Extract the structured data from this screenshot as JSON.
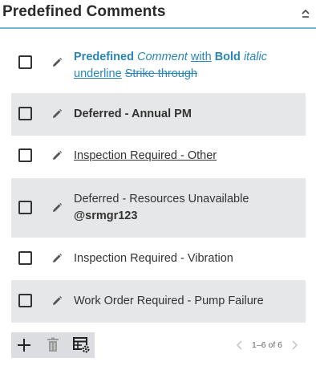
{
  "panel": {
    "title": "Predefined Comments",
    "collapse_icon": "chevron-up-icon"
  },
  "comments": [
    {
      "segments": [
        {
          "text": "Predefined",
          "style": "bold-blue"
        },
        {
          "text": " ",
          "style": "plain"
        },
        {
          "text": "Comment",
          "style": "italic-blue"
        },
        {
          "text": " ",
          "style": "plain"
        },
        {
          "text": "with",
          "style": "underline-blue"
        },
        {
          "text": " ",
          "style": "plain"
        },
        {
          "text": "Bold",
          "style": "bold-blue"
        },
        {
          "text": " ",
          "style": "plain"
        },
        {
          "text": "italic",
          "style": "italic-blue"
        },
        {
          "text": " ",
          "style": "plain"
        },
        {
          "text": "underline",
          "style": "underline-blue"
        },
        {
          "text": " ",
          "style": "plain"
        },
        {
          "text": "Strike through",
          "style": "strike-blue"
        }
      ],
      "shaded": false
    },
    {
      "segments": [
        {
          "text": "Deferred - Annual PM",
          "style": "bold"
        }
      ],
      "shaded": true
    },
    {
      "segments": [
        {
          "text": "Inspection Required - Other",
          "style": "underline"
        }
      ],
      "shaded": false
    },
    {
      "segments": [
        {
          "text": "Deferred - Resources Unavailable",
          "style": "plain"
        },
        {
          "text": "@srmgr123",
          "style": "bold-newline"
        }
      ],
      "shaded": true
    },
    {
      "segments": [
        {
          "text": "Inspection Required - Vibration",
          "style": "plain"
        }
      ],
      "shaded": false
    },
    {
      "segments": [
        {
          "text": "Work Order Required - Pump Failure",
          "style": "plain"
        }
      ],
      "shaded": true
    }
  ],
  "toolbar": {
    "add_icon": "plus-icon",
    "delete_icon": "trash-icon",
    "settings_icon": "table-settings-icon"
  },
  "pagination": {
    "info": "1–6 of 6",
    "prev_icon": "chevron-left-icon",
    "next_icon": "chevron-right-icon"
  },
  "colors": {
    "accent": "#2a85b8",
    "header_border": "#6fb6d9",
    "row_shade": "#e6e7e8",
    "toolbar_bg": "#dcdde0"
  }
}
